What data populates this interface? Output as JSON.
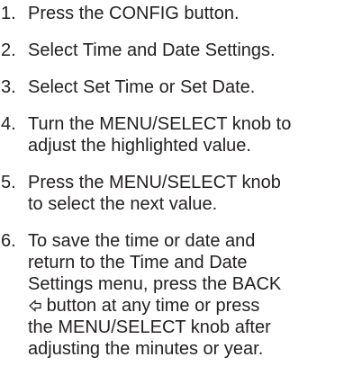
{
  "steps": [
    {
      "number": "1.",
      "lines": [
        "Press the CONFIG button."
      ]
    },
    {
      "number": "2.",
      "lines": [
        "Select Time and Date Settings."
      ]
    },
    {
      "number": "3.",
      "lines": [
        "Select Set Time or Set Date."
      ]
    },
    {
      "number": "4.",
      "lines": [
        "Turn the MENU/SELECT knob to",
        "adjust the highlighted value."
      ]
    },
    {
      "number": "5.",
      "lines": [
        "Press the MENU/SELECT knob",
        "to select the next value."
      ]
    },
    {
      "number": "6.",
      "lines": [
        "To save the time or date and",
        "return to the Time and Date",
        "Settings menu, press the BACK",
        "button at any time or press",
        "the MENU/SELECT knob after",
        "adjusting the minutes or year."
      ]
    }
  ],
  "icons": {
    "back": "back-arrow-icon"
  }
}
